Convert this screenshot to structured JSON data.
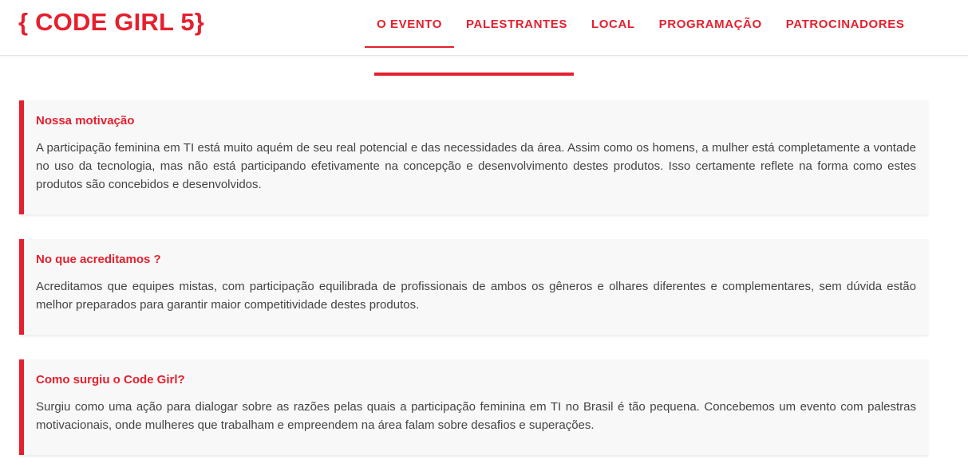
{
  "header": {
    "logo": "{ CODE GIRL 5}",
    "nav": [
      {
        "label": "O EVENTO",
        "active": true
      },
      {
        "label": "PALESTRANTES",
        "active": false
      },
      {
        "label": "LOCAL",
        "active": false
      },
      {
        "label": "PROGRAMAÇÃO",
        "active": false
      },
      {
        "label": "PATROCINADORES",
        "active": false
      }
    ]
  },
  "sections": [
    {
      "title": "Nossa motivação",
      "text": "A participação feminina em TI está muito aquém de seu real potencial e das necessidades da área. Assim como os homens, a mulher está completamente a vontade no uso da tecnologia, mas não está participando efetivamente na concepção e desenvolvimento destes produtos. Isso certamente reflete na forma como estes produtos são concebidos e desenvolvidos."
    },
    {
      "title": "No que acreditamos ?",
      "text": "Acreditamos que equipes mistas, com participação equilibrada de profissionais de ambos os gêneros e olhares diferentes e complementares, sem dúvida estão melhor preparados para garantir maior competitividade destes produtos."
    },
    {
      "title": "Como surgiu o Code Girl?",
      "text": "Surgiu como uma ação para dialogar sobre as razões pelas quais a participação feminina em TI no Brasil é tão pequena. Concebemos um evento com palestras motivacionais, onde mulheres que trabalham e empreendem na área falam sobre desafios e superações."
    }
  ],
  "colors": {
    "accent": "#e5202e",
    "card_background": "#f8f8f8",
    "body_text": "#444444"
  }
}
